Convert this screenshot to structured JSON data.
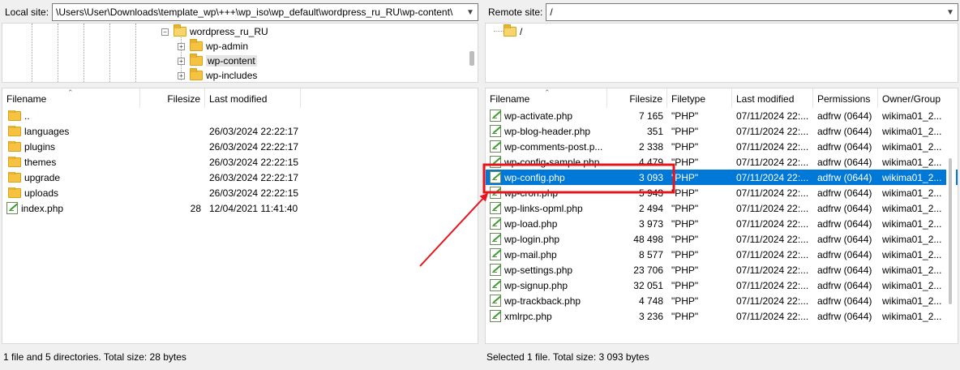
{
  "local": {
    "label": "Local site:",
    "path": "\\Users\\User\\Downloads\\template_wp\\+++\\wp_iso\\wp_default\\wordpress_ru_RU\\wp-content\\",
    "tree": [
      {
        "label": "wordpress_ru_RU",
        "expander": "−",
        "open": true
      },
      {
        "label": "wp-admin",
        "expander": "+"
      },
      {
        "label": "wp-content",
        "expander": "+"
      },
      {
        "label": "wp-includes",
        "expander": "+"
      }
    ],
    "columns": {
      "name": "Filename",
      "size": "Filesize",
      "modified": "Last modified"
    },
    "rows": [
      {
        "name": "..",
        "size": "",
        "modified": "",
        "type": "folder"
      },
      {
        "name": "languages",
        "size": "",
        "modified": "26/03/2024 22:22:17",
        "type": "folder"
      },
      {
        "name": "plugins",
        "size": "",
        "modified": "26/03/2024 22:22:17",
        "type": "folder"
      },
      {
        "name": "themes",
        "size": "",
        "modified": "26/03/2024 22:22:15",
        "type": "folder"
      },
      {
        "name": "upgrade",
        "size": "",
        "modified": "26/03/2024 22:22:17",
        "type": "folder"
      },
      {
        "name": "uploads",
        "size": "",
        "modified": "26/03/2024 22:22:15",
        "type": "folder"
      },
      {
        "name": "index.php",
        "size": "28",
        "modified": "12/04/2021 11:41:40",
        "type": "file"
      }
    ],
    "status": "1 file and 5 directories. Total size: 28 bytes"
  },
  "remote": {
    "label": "Remote site:",
    "path": "/",
    "tree": [
      {
        "label": "/"
      }
    ],
    "columns": {
      "name": "Filename",
      "size": "Filesize",
      "type": "Filetype",
      "modified": "Last modified",
      "perms": "Permissions",
      "owner": "Owner/Group"
    },
    "rows": [
      {
        "name": "wp-activate.php",
        "size": "7 165",
        "type": "\"PHP\"",
        "modified": "07/11/2024 22:...",
        "perms": "adfrw (0644)",
        "owner": "wikima01_2..."
      },
      {
        "name": "wp-blog-header.php",
        "size": "351",
        "type": "\"PHP\"",
        "modified": "07/11/2024 22:...",
        "perms": "adfrw (0644)",
        "owner": "wikima01_2..."
      },
      {
        "name": "wp-comments-post.p...",
        "size": "2 338",
        "type": "\"PHP\"",
        "modified": "07/11/2024 22:...",
        "perms": "adfrw (0644)",
        "owner": "wikima01_2..."
      },
      {
        "name": "wp-config-sample.php",
        "size": "4 479",
        "type": "\"PHP\"",
        "modified": "07/11/2024 22:...",
        "perms": "adfrw (0644)",
        "owner": "wikima01_2..."
      },
      {
        "name": "wp-config.php",
        "size": "3 093",
        "type": "\"PHP\"",
        "modified": "07/11/2024 22:...",
        "perms": "adfrw (0644)",
        "owner": "wikima01_2...",
        "selected": true
      },
      {
        "name": "wp-cron.php",
        "size": "5 943",
        "type": "\"PHP\"",
        "modified": "07/11/2024 22:...",
        "perms": "adfrw (0644)",
        "owner": "wikima01_2..."
      },
      {
        "name": "wp-links-opml.php",
        "size": "2 494",
        "type": "\"PHP\"",
        "modified": "07/11/2024 22:...",
        "perms": "adfrw (0644)",
        "owner": "wikima01_2..."
      },
      {
        "name": "wp-load.php",
        "size": "3 973",
        "type": "\"PHP\"",
        "modified": "07/11/2024 22:...",
        "perms": "adfrw (0644)",
        "owner": "wikima01_2..."
      },
      {
        "name": "wp-login.php",
        "size": "48 498",
        "type": "\"PHP\"",
        "modified": "07/11/2024 22:...",
        "perms": "adfrw (0644)",
        "owner": "wikima01_2..."
      },
      {
        "name": "wp-mail.php",
        "size": "8 577",
        "type": "\"PHP\"",
        "modified": "07/11/2024 22:...",
        "perms": "adfrw (0644)",
        "owner": "wikima01_2..."
      },
      {
        "name": "wp-settings.php",
        "size": "23 706",
        "type": "\"PHP\"",
        "modified": "07/11/2024 22:...",
        "perms": "adfrw (0644)",
        "owner": "wikima01_2..."
      },
      {
        "name": "wp-signup.php",
        "size": "32 051",
        "type": "\"PHP\"",
        "modified": "07/11/2024 22:...",
        "perms": "adfrw (0644)",
        "owner": "wikima01_2..."
      },
      {
        "name": "wp-trackback.php",
        "size": "4 748",
        "type": "\"PHP\"",
        "modified": "07/11/2024 22:...",
        "perms": "adfrw (0644)",
        "owner": "wikima01_2..."
      },
      {
        "name": "xmlrpc.php",
        "size": "3 236",
        "type": "\"PHP\"",
        "modified": "07/11/2024 22:...",
        "perms": "adfrw (0644)",
        "owner": "wikima01_2..."
      }
    ],
    "status": "Selected 1 file. Total size: 3 093 bytes"
  },
  "icons": {
    "folder": "folder-icon",
    "file": "php-file-icon",
    "dropdown": "chevron-down-icon"
  },
  "colors": {
    "selection": "#0078d7",
    "highlight_box": "#e8141b",
    "folder": "#f5c242"
  }
}
